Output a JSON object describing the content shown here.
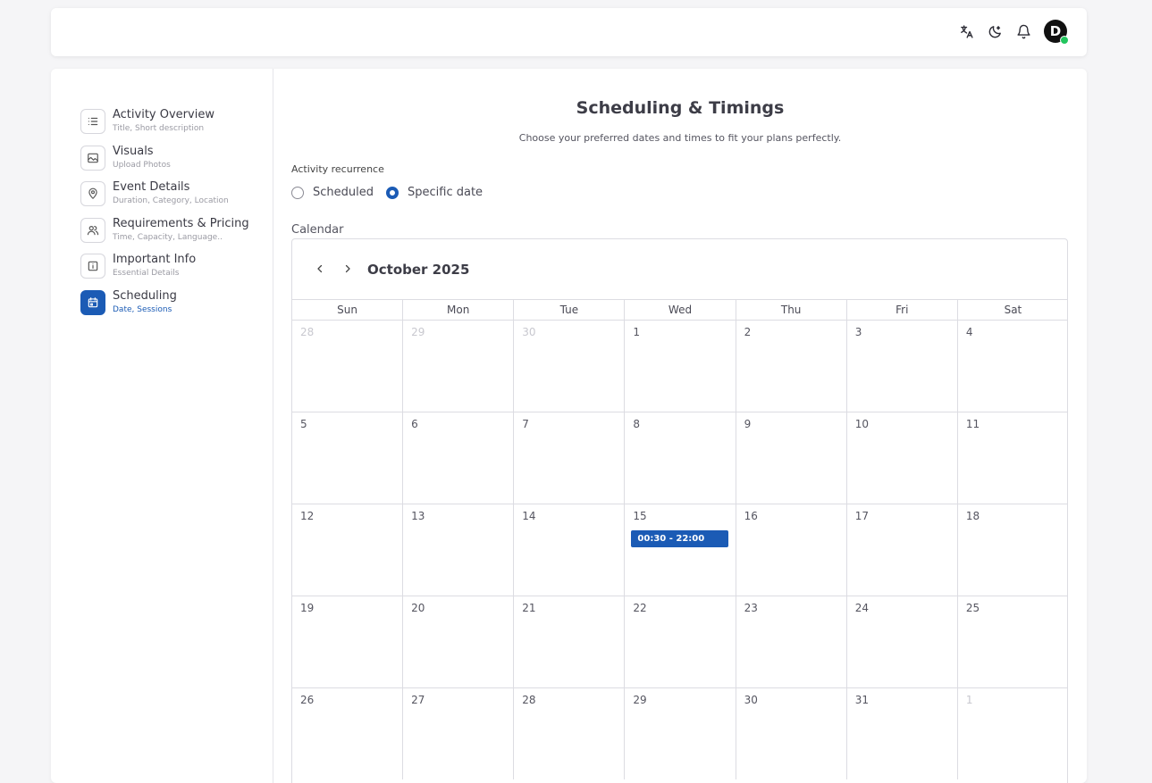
{
  "header": {
    "avatar_letter": "D"
  },
  "sidebar": {
    "items": [
      {
        "title": "Activity Overview",
        "sub": "Title, Short description",
        "icon": "list-icon"
      },
      {
        "title": "Visuals",
        "sub": "Upload Photos",
        "icon": "image-icon"
      },
      {
        "title": "Event Details",
        "sub": "Duration, Category, Location",
        "icon": "location-pin-icon"
      },
      {
        "title": "Requirements & Pricing",
        "sub": "Time, Capacity, Language..",
        "icon": "users-icon"
      },
      {
        "title": "Important Info",
        "sub": "Essential Details",
        "icon": "info-icon"
      },
      {
        "title": "Scheduling",
        "sub": "Date, Sessions",
        "icon": "calendar-icon"
      }
    ]
  },
  "main": {
    "title": "Scheduling & Timings",
    "subtitle": "Choose your preferred dates and times to fit your plans perfectly.",
    "recurrence_label": "Activity recurrence",
    "recurrence_options": [
      "Scheduled",
      "Specific date"
    ],
    "recurrence_selected": "Specific date",
    "calendar_label": "Calendar"
  },
  "calendar": {
    "month": "October 2025",
    "weekdays": [
      "Sun",
      "Mon",
      "Tue",
      "Wed",
      "Thu",
      "Fri",
      "Sat"
    ],
    "days": [
      "28",
      "29",
      "30",
      "1",
      "2",
      "3",
      "4",
      "5",
      "6",
      "7",
      "8",
      "9",
      "10",
      "11",
      "12",
      "13",
      "14",
      "15",
      "16",
      "17",
      "18",
      "19",
      "20",
      "21",
      "22",
      "23",
      "24",
      "25",
      "26",
      "27",
      "28",
      "29",
      "30",
      "31",
      "1"
    ],
    "muted_days": [
      0,
      1,
      2,
      34
    ],
    "event": {
      "day_index": 17,
      "label": "00:30 - 22:00"
    }
  },
  "colors": {
    "accent": "#1b5bb5",
    "online": "#22c55e"
  }
}
